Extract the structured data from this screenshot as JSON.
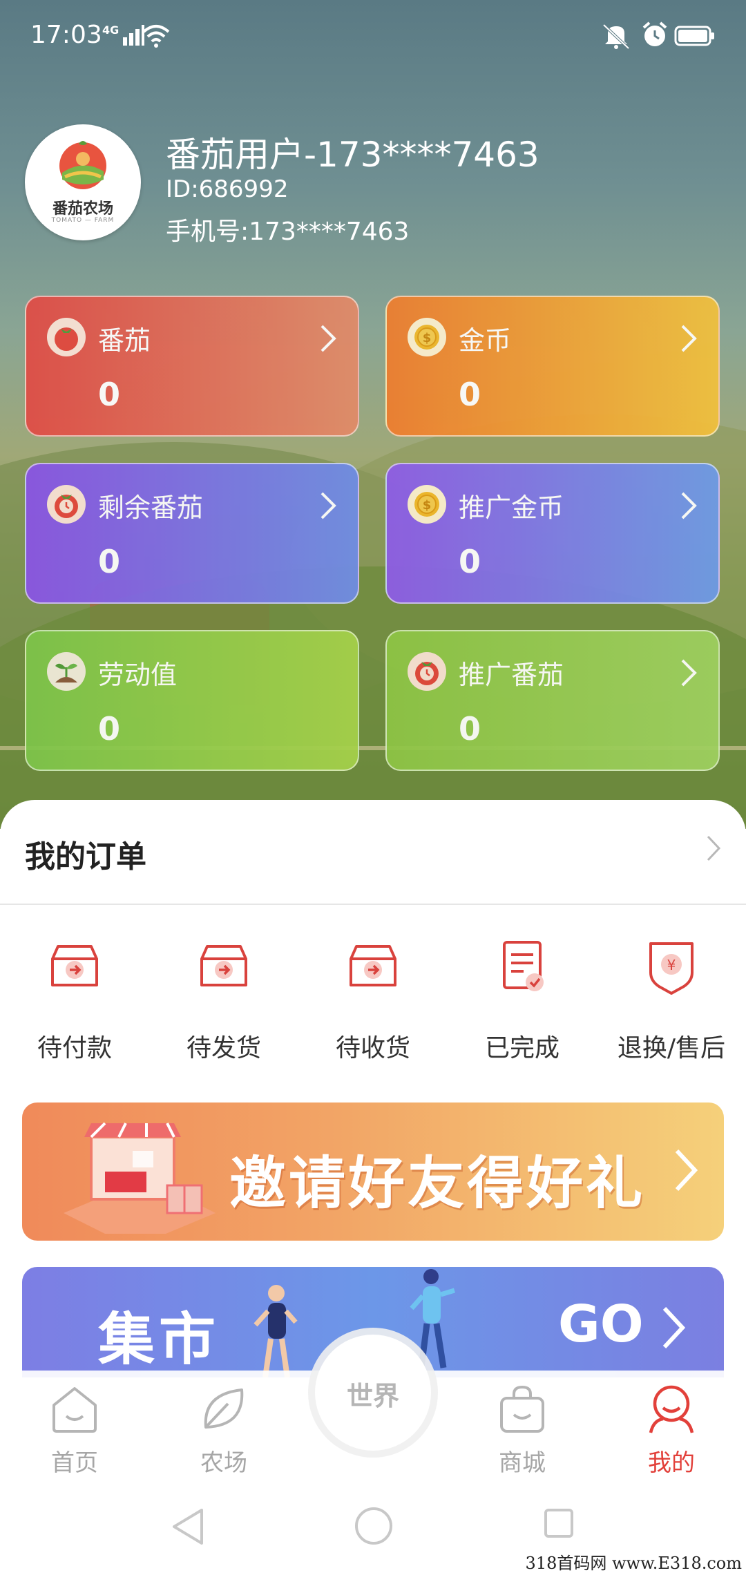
{
  "status_bar": {
    "time": "17:03",
    "network": "4G",
    "icons": [
      "signal-icon",
      "wifi-icon",
      "mute-icon",
      "alarm-icon",
      "battery-icon"
    ]
  },
  "profile": {
    "avatar_text": "番茄农场",
    "avatar_subtext": "TOMATO — FARM",
    "name": "番茄用户-173****7463",
    "id": "ID:686992",
    "phone": "手机号:173****7463"
  },
  "assets": [
    {
      "label": "番茄",
      "value": "0",
      "icon": "tomato-icon"
    },
    {
      "label": "金币",
      "value": "0",
      "icon": "coin-icon"
    },
    {
      "label": "剩余番茄",
      "value": "0",
      "icon": "tomato-clock-icon"
    },
    {
      "label": "推广金币",
      "value": "0",
      "icon": "coin-icon"
    },
    {
      "label": "劳动值",
      "value": "0",
      "icon": "sprout-icon"
    },
    {
      "label": "推广番茄",
      "value": "0",
      "icon": "tomato-clock-icon"
    }
  ],
  "orders": {
    "title": "我的订单",
    "items": [
      {
        "label": "待付款",
        "icon": "box-arrow-icon"
      },
      {
        "label": "待发货",
        "icon": "box-arrow-icon"
      },
      {
        "label": "待收货",
        "icon": "box-arrow-icon"
      },
      {
        "label": "已完成",
        "icon": "document-check-icon"
      },
      {
        "label": "退换/售后",
        "icon": "refund-icon"
      }
    ]
  },
  "banners": {
    "invite": "邀请好友得好礼",
    "market": "集市",
    "market_go": "GO"
  },
  "bottom_nav": {
    "items": [
      {
        "label": "首页",
        "icon": "home-icon",
        "active": false
      },
      {
        "label": "农场",
        "icon": "leaf-icon",
        "active": false
      },
      {
        "label": "商城",
        "icon": "shopping-bag-icon",
        "active": false
      },
      {
        "label": "我的",
        "icon": "user-icon",
        "active": true
      }
    ],
    "center": "世界"
  },
  "watermark": "318首码网 www.E318.com",
  "colors": {
    "accent_red": "#e2403a",
    "order_icon_red": "#d9423d",
    "inactive_gray": "#a6a6a6"
  }
}
